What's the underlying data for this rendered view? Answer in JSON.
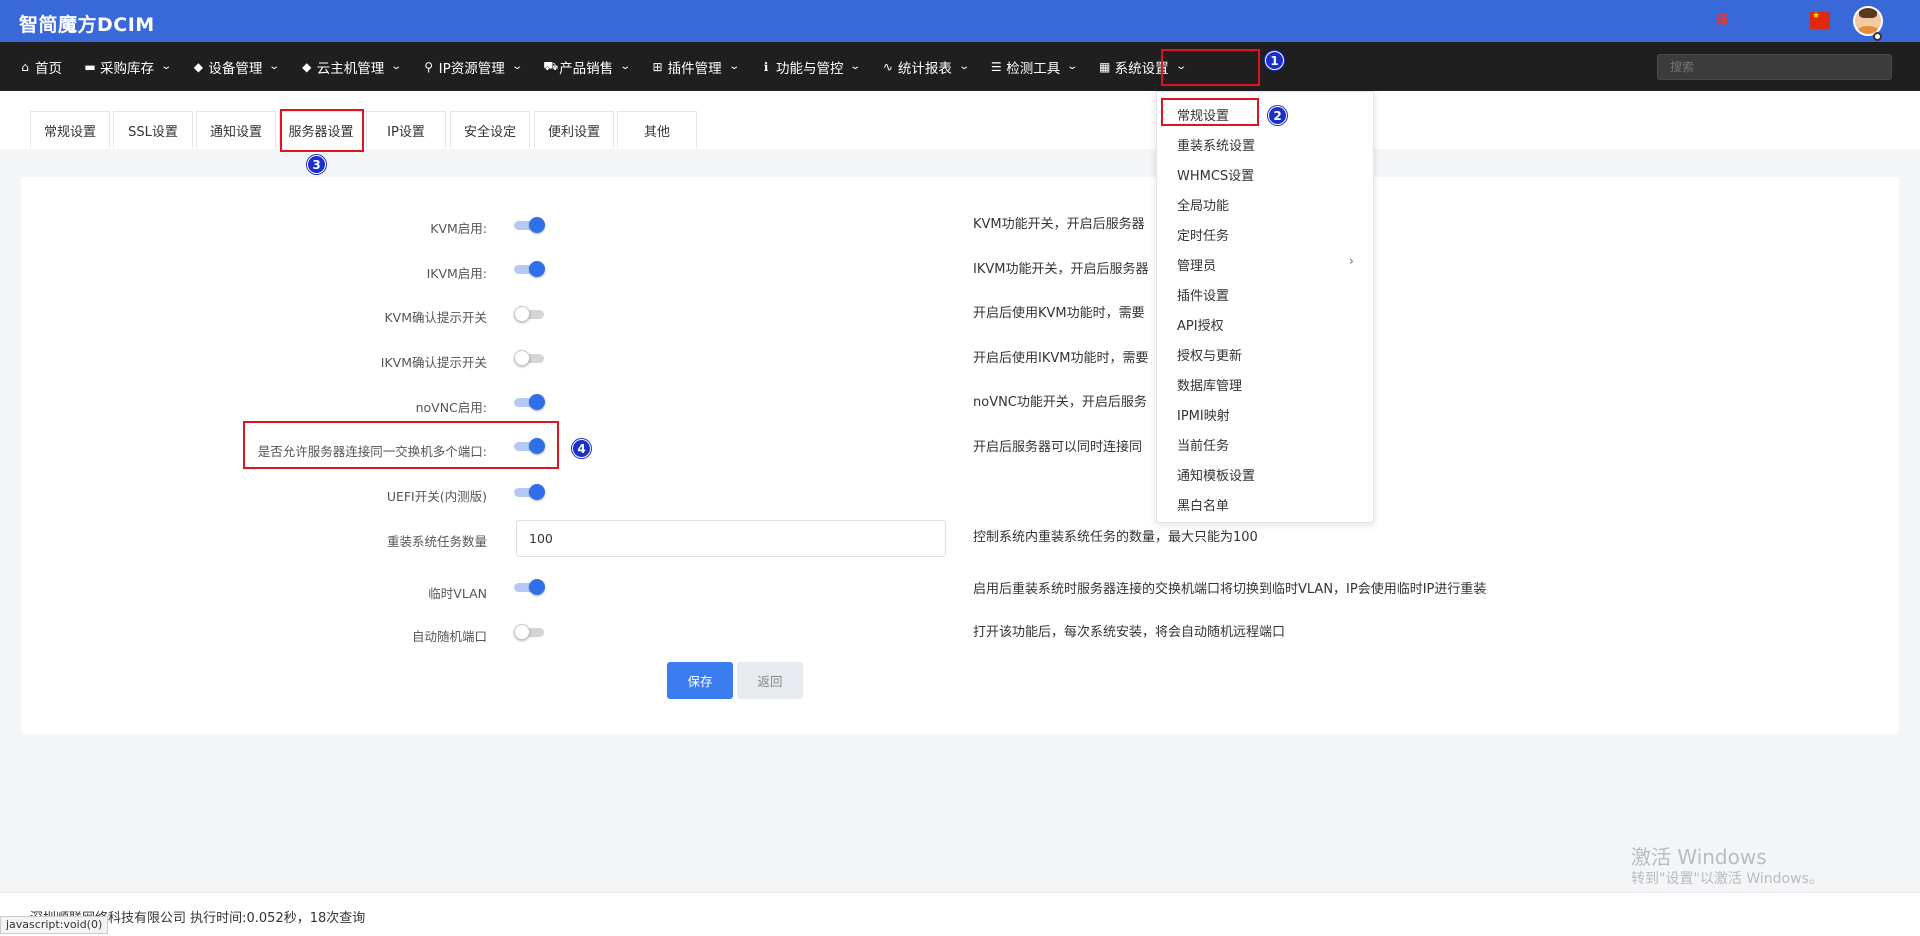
{
  "header": {
    "brand": "智简魔方DCIM",
    "lang_icon": "translate-icon",
    "flag_icon": "china-flag-icon"
  },
  "nav": {
    "items": [
      {
        "icon": "⌂",
        "label": "首页",
        "has_chevron": false
      },
      {
        "icon": "▬",
        "label": "采购库存",
        "has_chevron": true
      },
      {
        "icon": "◆",
        "label": "设备管理",
        "has_chevron": true
      },
      {
        "icon": "◆",
        "label": "云主机管理",
        "has_chevron": true
      },
      {
        "icon": "⚲",
        "label": "IP资源管理",
        "has_chevron": true
      },
      {
        "icon": "⛟",
        "label": "产品销售",
        "has_chevron": true
      },
      {
        "icon": "⊞",
        "label": "插件管理",
        "has_chevron": true
      },
      {
        "icon": "ℹ",
        "label": "功能与管控",
        "has_chevron": true
      },
      {
        "icon": "∿",
        "label": "统计报表",
        "has_chevron": true
      },
      {
        "icon": "☰",
        "label": "检测工具",
        "has_chevron": true
      },
      {
        "icon": "▦",
        "label": "系统设置",
        "has_chevron": true
      }
    ],
    "search_placeholder": "搜索",
    "chevron": "⌄"
  },
  "tabs": [
    "常规设置",
    "SSL设置",
    "通知设置",
    "服务器设置",
    "IP设置",
    "安全设定",
    "便利设置",
    "其他"
  ],
  "form": {
    "rows": [
      {
        "label": "KVM启用:",
        "toggle": "on",
        "help": "KVM功能开关，开启后服务器"
      },
      {
        "label": "IKVM启用:",
        "toggle": "on",
        "help": "IKVM功能开关，开启后服务器"
      },
      {
        "label": "KVM确认提示开关",
        "toggle": "off",
        "help": "开启后使用KVM功能时，需要"
      },
      {
        "label": "IKVM确认提示开关",
        "toggle": "off",
        "help": "开启后使用IKVM功能时，需要"
      },
      {
        "label": "noVNC启用:",
        "toggle": "on",
        "help": "noVNC功能开关，开启后服务"
      },
      {
        "label": "是否允许服务器连接同一交换机多个端口:",
        "toggle": "on",
        "help": "开启后服务器可以同时连接同"
      },
      {
        "label": "UEFI开关(内测版)",
        "toggle": "on",
        "help": ""
      },
      {
        "label": "重装系统任务数量",
        "input": "100",
        "help": "控制系统内重装系统任务的数量，最大只能为100"
      },
      {
        "label": "临时VLAN",
        "toggle": "on",
        "help": "启用后重装系统时服务器连接的交换机端口将切换到临时VLAN，IP会使用临时IP进行重装"
      },
      {
        "label": "自动随机端口",
        "toggle": "off",
        "help": "打开该功能后，每次系统安装，将会自动随机远程端口"
      }
    ],
    "save_label": "保存",
    "back_label": "返回"
  },
  "dropdown": {
    "items": [
      "常规设置",
      "重装系统设置",
      "WHMCS设置",
      "全局功能",
      "定时任务",
      "管理员",
      "插件设置",
      "API授权",
      "授权与更新",
      "数据库管理",
      "IPMI映射",
      "当前任务",
      "通知模板设置",
      "黑白名单"
    ],
    "submenu_chevron": "›"
  },
  "annotations": [
    "1",
    "2",
    "3",
    "4"
  ],
  "footer": {
    "text": "深圳顺联网络科技有限公司    执行时间:0.052秒，18次查询",
    "status_url": "javascript:void(0)"
  },
  "watermark": {
    "line1": "激活 Windows",
    "line2": "转到\"设置\"以激活 Windows。"
  },
  "colors": {
    "header_bg": "#3968d8",
    "navbar_bg": "#1f1f1f",
    "accent": "#2f6fea",
    "annotation_red": "#e0141e",
    "annotation_badge": "#1c2fc8"
  }
}
